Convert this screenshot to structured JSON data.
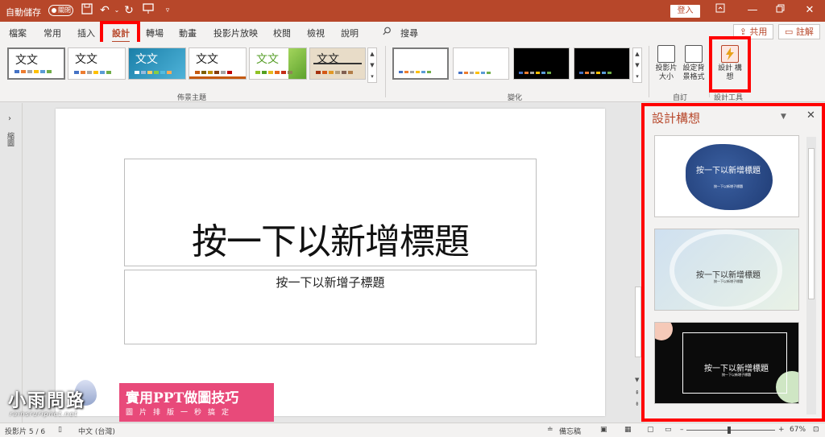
{
  "title_bar": {
    "autosave_label": "自動儲存",
    "autosave_state": "關閉",
    "sign_in": "登入",
    "icons": [
      "save-icon",
      "undo-icon",
      "redo-icon",
      "present-icon",
      "customize-qat-icon"
    ],
    "window_icons": [
      "ribbon-display-icon",
      "minimize-icon",
      "restore-icon",
      "close-icon"
    ]
  },
  "tabs": [
    "檔案",
    "常用",
    "插入",
    "設計",
    "轉場",
    "動畫",
    "投影片放映",
    "校閱",
    "檢視",
    "說明"
  ],
  "active_tab": "設計",
  "search_label": "搜尋",
  "share_label": "共用",
  "comments_label": "註解",
  "ribbon": {
    "themes_label": "佈景主題",
    "variants_label": "變化",
    "customize_label": "自訂",
    "designer_label": "設計工具",
    "theme_sample_text": "文文",
    "slide_size_label": "投影片 大小",
    "format_bg_label": "設定背 景格式",
    "design_ideas_btn": "設計 構想"
  },
  "left_pane_label": "縮圖",
  "slide": {
    "title_placeholder": "按一下以新增標題",
    "subtitle_placeholder": "按一下以新增子標題"
  },
  "designer_pane": {
    "title": "設計構想",
    "idea_title": "按一下以新增標題",
    "idea_subtitle": "按一下以新增子標題"
  },
  "watermark": {
    "site_name": "小雨問路",
    "url": "rainsruripnet.net",
    "headline": "實用PPT做圖技巧",
    "tagline": "圖片排版一秒搞定"
  },
  "status_bar": {
    "slide_count": "投影片 5 / 6",
    "language": "中文 (台灣)",
    "notes": "備忘稿",
    "zoom": "67%"
  },
  "colors": {
    "accent": "#b7472a",
    "highlight": "#ff0000",
    "watermark_pink": "#e84a7a"
  }
}
